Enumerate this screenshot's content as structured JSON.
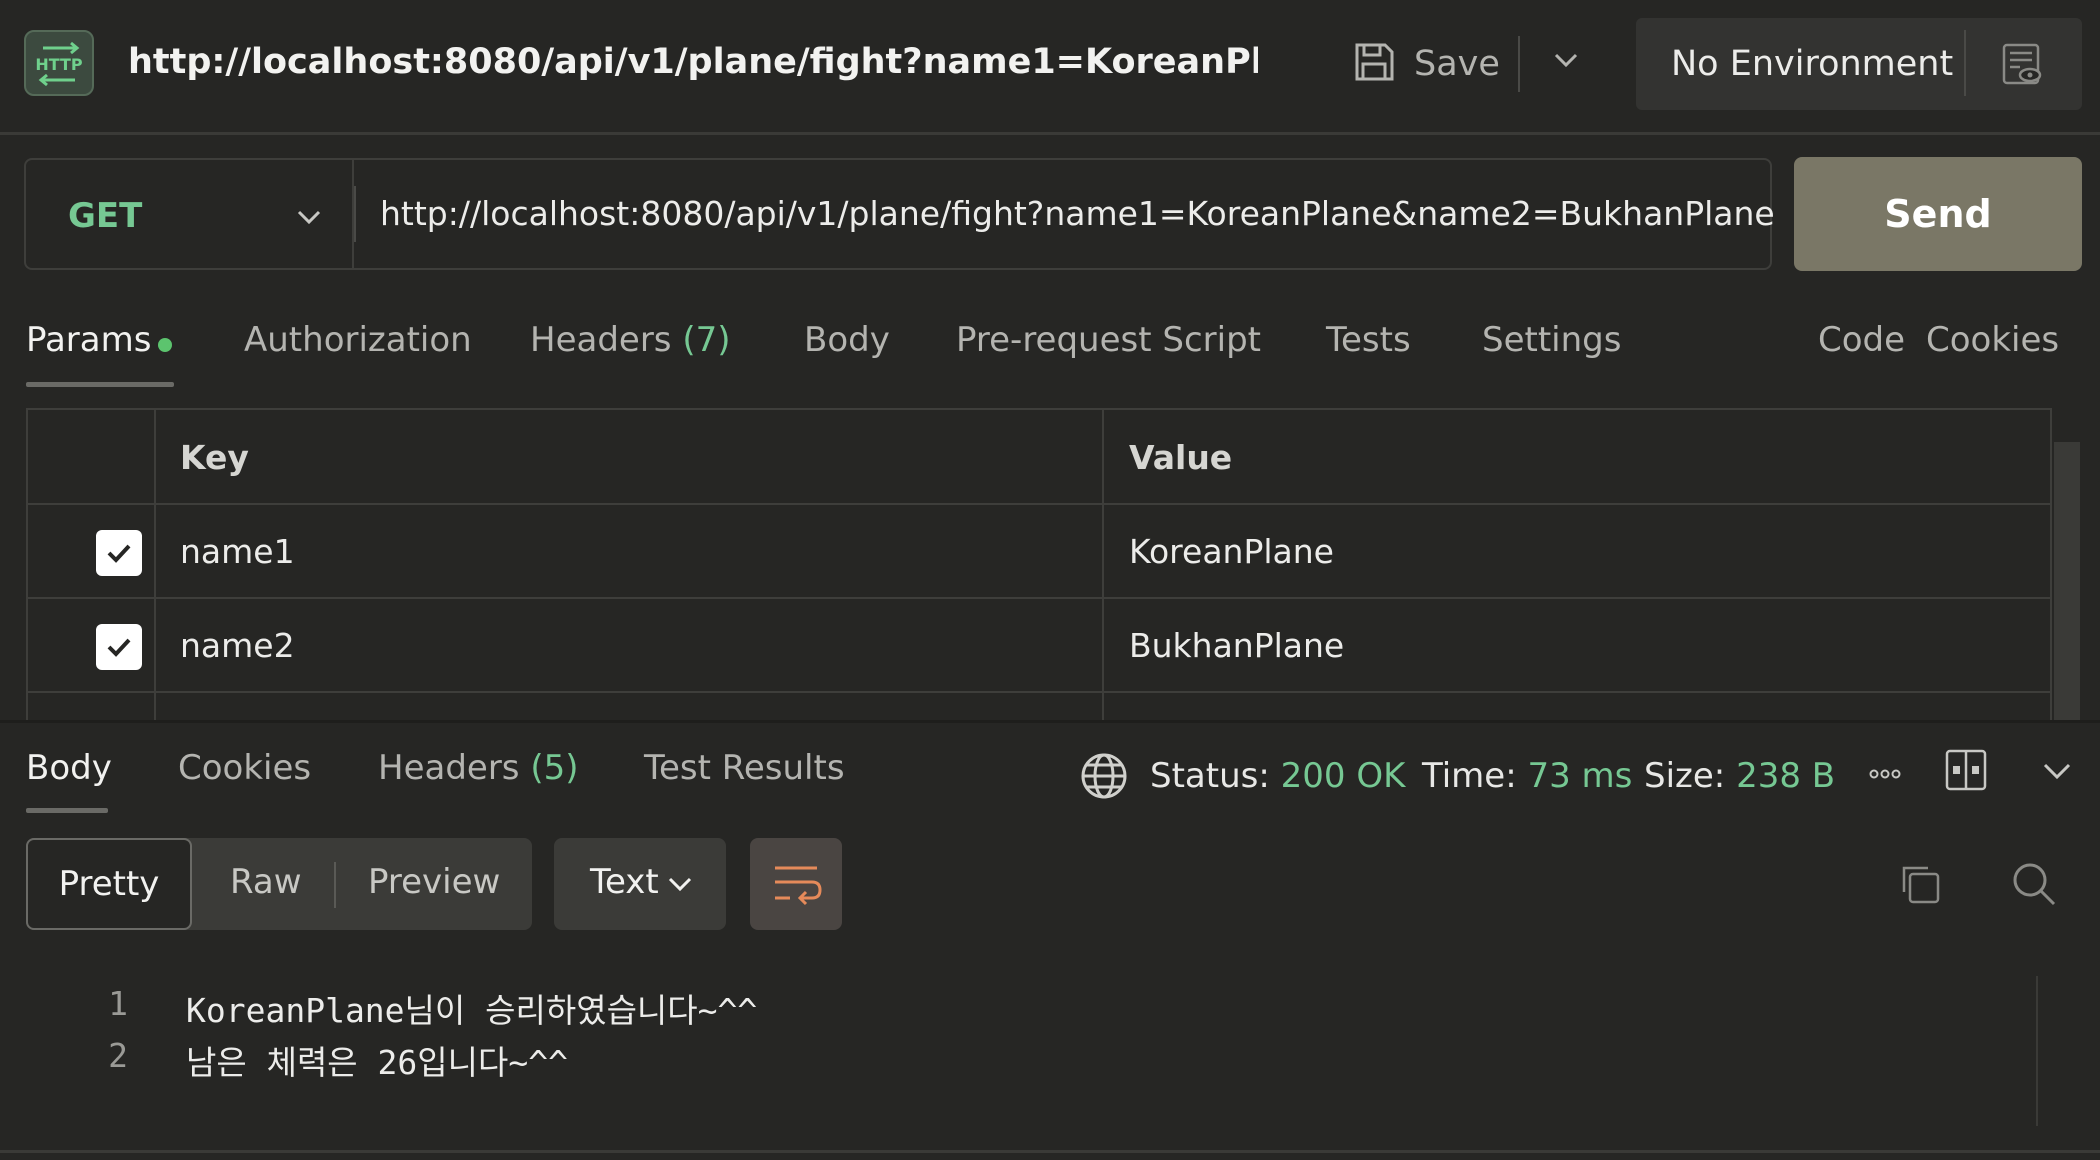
{
  "header": {
    "method_badge": "HTTP",
    "title": "http://localhost:8080/api/v1/plane/fight?name1=KoreanPlane&n...",
    "save_label": "Save",
    "environment": "No Environment"
  },
  "request": {
    "method": "GET",
    "url": "http://localhost:8080/api/v1/plane/fight?name1=KoreanPlane&name2=BukhanPlane",
    "send_label": "Send"
  },
  "request_tabs": {
    "params": "Params",
    "authorization": "Authorization",
    "headers": "Headers",
    "headers_count": "(7)",
    "body": "Body",
    "pre_request": "Pre-request Script",
    "tests": "Tests",
    "settings": "Settings",
    "code": "Code",
    "cookies": "Cookies"
  },
  "params_table": {
    "columns": [
      "Key",
      "Value"
    ],
    "rows": [
      {
        "checked": true,
        "key": "name1",
        "value": "KoreanPlane"
      },
      {
        "checked": true,
        "key": "name2",
        "value": "BukhanPlane"
      }
    ]
  },
  "response_tabs": {
    "body": "Body",
    "cookies": "Cookies",
    "headers": "Headers",
    "headers_count": "(5)",
    "test_results": "Test Results"
  },
  "response_status": {
    "status_label": "Status:",
    "status_value": "200 OK",
    "time_label": "Time:",
    "time_value": "73 ms",
    "size_label": "Size:",
    "size_value": "238 B"
  },
  "format_bar": {
    "pretty": "Pretty",
    "raw": "Raw",
    "preview": "Preview",
    "type": "Text"
  },
  "response_body": [
    {
      "line": "1",
      "text": "KoreanPlane님이 승리하였습니다~^^"
    },
    {
      "line": "2",
      "text": "남은 체력은 26입니다~^^"
    }
  ],
  "colors": {
    "background": "#262624",
    "accent_green": "#76c893",
    "link_blue": "#5b9bf0",
    "send_button": "#7a7766"
  },
  "icons": [
    "http-icon",
    "save-icon",
    "chevron-down-icon",
    "environment-eye-icon",
    "globe-icon",
    "more-icon",
    "layout-icon",
    "wrap-icon",
    "copy-icon",
    "search-icon",
    "check-icon"
  ]
}
